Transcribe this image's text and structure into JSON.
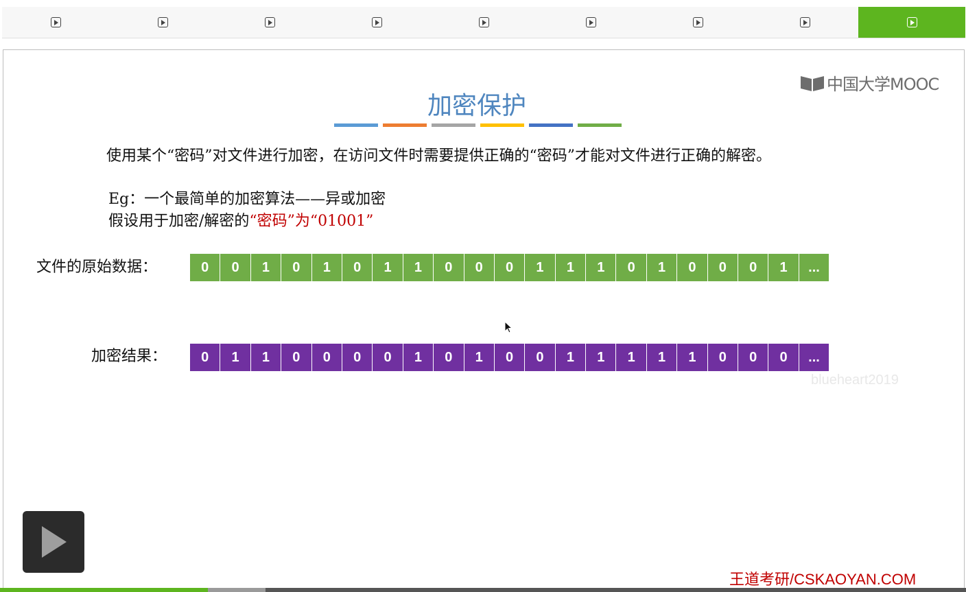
{
  "tabs": {
    "count": 9,
    "active_index": 8,
    "icon": "play-icon"
  },
  "colors": {
    "tab_active": "#5db51f",
    "title": "#4f86bf",
    "title_bars": [
      "#5b9bd5",
      "#ed7d31",
      "#a5a5a5",
      "#ffc000",
      "#4472c4",
      "#70ad47"
    ],
    "original_data": "#70ad47",
    "encrypted_result": "#7030a0",
    "highlight": "#c00000"
  },
  "slide": {
    "logo_text": "中国大学MOOC",
    "title": "加密保护",
    "description": "使用某个“密码”对文件进行加密，在访问文件时需要提供正确的“密码”才能对文件进行正确的解密。",
    "eg_line1": "Eg：一个最简单的加密算法——异或加密",
    "eg_line2_prefix": "假设用于加密/解密的",
    "eg_line2_highlight": "“密码”为“01001”",
    "original_label": "文件的原始数据：",
    "original_bits": [
      "0",
      "0",
      "1",
      "0",
      "1",
      "0",
      "1",
      "1",
      "0",
      "0",
      "0",
      "1",
      "1",
      "1",
      "0",
      "1",
      "0",
      "0",
      "0",
      "1",
      "..."
    ],
    "encrypted_label": "加密结果：",
    "encrypted_bits": [
      "0",
      "1",
      "1",
      "0",
      "0",
      "0",
      "0",
      "1",
      "0",
      "1",
      "0",
      "0",
      "1",
      "1",
      "1",
      "1",
      "1",
      "0",
      "0",
      "0",
      "..."
    ],
    "watermark": "blueheart2019",
    "footer_brand": "王道考研/CSKAOYAN.COM"
  },
  "player": {
    "play_icon": "play-icon",
    "progress_played": 0.215,
    "progress_buffered": 0.275
  }
}
